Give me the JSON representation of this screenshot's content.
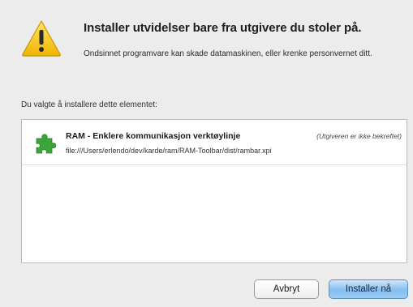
{
  "dialog": {
    "title": "Installer utvidelser bare fra utgivere du stoler på.",
    "subtitle": "Ondsinnet programvare kan skade datamaskinen, eller krenke personvernet ditt.",
    "list_label": "Du valgte å installere dette elementet:",
    "items": [
      {
        "name": "RAM - Enklere kommunikasjon verktøylinje",
        "note": "(Utgiveren er ikke bekreftet)",
        "path": "file:///Users/erlendo/dev/karde/ram/RAM-Toolbar/dist/rambar.xpi",
        "icon": "puzzle-piece-icon"
      }
    ],
    "buttons": {
      "cancel": "Avbryt",
      "install": "Installer nå"
    },
    "colors": {
      "background": "#ececec",
      "warning_yellow": "#f5c518",
      "puzzle_green": "#3aa63a",
      "install_button_blue": "#84bdf0"
    }
  }
}
